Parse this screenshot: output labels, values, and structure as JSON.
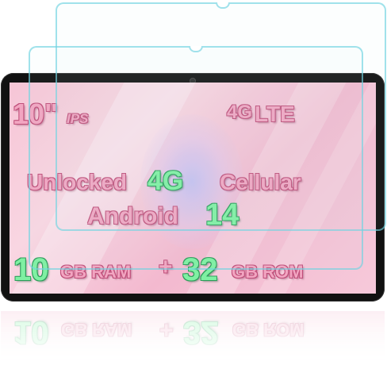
{
  "screen_text": {
    "size": "10\"",
    "panel": "IPS",
    "network_icon": "4G",
    "network": "LTE",
    "unlocked": "Unlocked",
    "four_g": "4G",
    "cellular": "Cellular",
    "android": "Android",
    "android_version": "14",
    "ram_value": "10",
    "ram_label": "GB RAM",
    "plus": "+",
    "rom_value": "32",
    "rom_label": "GB ROM"
  },
  "colors": {
    "bezel": "#111111",
    "screen_pink": "#f6c5d6",
    "text_pink": "#f2a5c1",
    "text_green": "#7ff0a2",
    "protector_edge": "#6ed2e1"
  },
  "icons": [
    "camera-icon",
    "signal-4g-icon"
  ]
}
